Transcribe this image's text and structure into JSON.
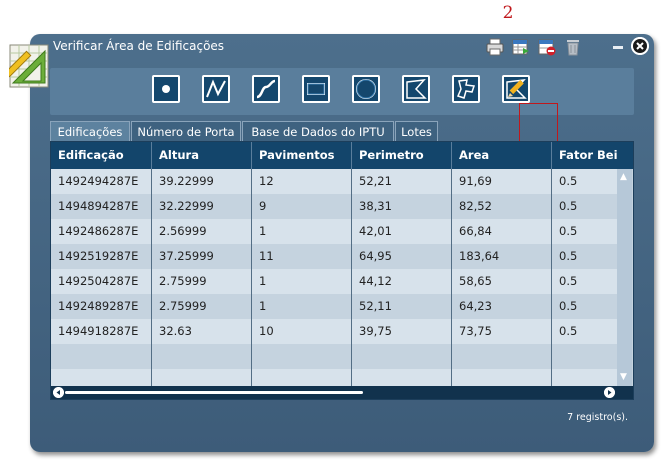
{
  "annotation": "2",
  "window": {
    "title": "Verificar Área de Edificações"
  },
  "title_buttons": [
    {
      "name": "print-icon"
    },
    {
      "name": "export-table-icon"
    },
    {
      "name": "remove-selection-icon"
    },
    {
      "name": "trash-icon"
    }
  ],
  "tools": [
    {
      "name": "point-tool-icon"
    },
    {
      "name": "polyline-tool-icon"
    },
    {
      "name": "curve-tool-icon"
    },
    {
      "name": "rectangle-tool-icon"
    },
    {
      "name": "circle-tool-icon"
    },
    {
      "name": "polygon-tool-icon"
    },
    {
      "name": "freehand-tool-icon"
    },
    {
      "name": "edit-pencil-tool-icon"
    }
  ],
  "tabs": [
    "Edificações",
    "Número de Porta",
    "Base de Dados do IPTU",
    "Lotes"
  ],
  "active_tab": "Edificações",
  "table": {
    "columns": [
      "Edificação",
      "Altura",
      "Pavimentos",
      "Perimetro",
      "Area",
      "Fator Beira"
    ],
    "rows": [
      [
        "1492494287E",
        "39.22999",
        "12",
        "52,21",
        "91,69",
        "0.5"
      ],
      [
        "1494894287E",
        "32.22999",
        "9",
        "38,31",
        "82,52",
        "0.5"
      ],
      [
        "1492486287E",
        "2.56999",
        "1",
        "42,01",
        "66,84",
        "0.5"
      ],
      [
        "1492519287E",
        "37.25999",
        "11",
        "64,95",
        "183,64",
        "0.5"
      ],
      [
        "1492504287E",
        "2.75999",
        "1",
        "44,12",
        "58,65",
        "0.5"
      ],
      [
        "1492489287E",
        "2.75999",
        "1",
        "52,11",
        "64,23",
        "0.5"
      ],
      [
        "1494918287E",
        "32.63",
        "10",
        "39,75",
        "73,75",
        "0.5"
      ]
    ]
  },
  "status": "7 registro(s).",
  "colors": {
    "window_bg": "#4d6f8c",
    "toolbar_bg": "#5a7e9c",
    "header_bg": "#13456b",
    "row_light": "#d7e2eb",
    "row_dark": "#c5d3df",
    "annotation_red": "#c0181c"
  }
}
